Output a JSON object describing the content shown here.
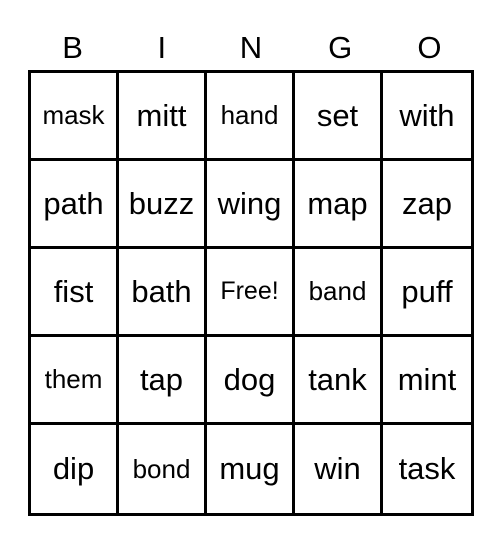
{
  "header": [
    "B",
    "I",
    "N",
    "G",
    "O"
  ],
  "rows": [
    [
      "mask",
      "mitt",
      "hand",
      "set",
      "with"
    ],
    [
      "path",
      "buzz",
      "wing",
      "map",
      "zap"
    ],
    [
      "fist",
      "bath",
      "Free!",
      "band",
      "puff"
    ],
    [
      "them",
      "tap",
      "dog",
      "tank",
      "mint"
    ],
    [
      "dip",
      "bond",
      "mug",
      "win",
      "task"
    ]
  ]
}
